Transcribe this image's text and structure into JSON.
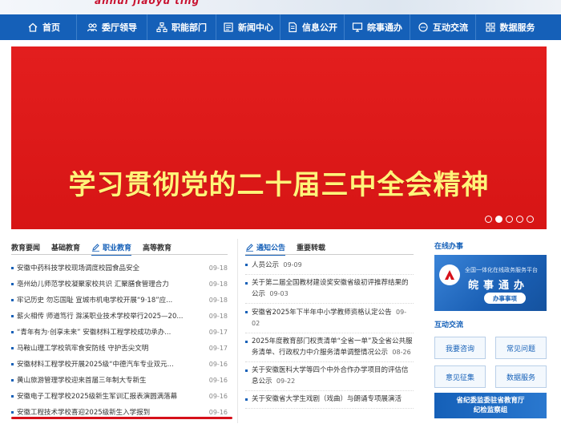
{
  "top": {
    "brand": "anhui jiaoyu ting"
  },
  "nav": [
    {
      "label": "首页",
      "icon": "home-icon"
    },
    {
      "label": "委厅领导",
      "icon": "users-icon"
    },
    {
      "label": "职能部门",
      "icon": "org-chart-icon"
    },
    {
      "label": "新闻中心",
      "icon": "newspaper-icon"
    },
    {
      "label": "信息公开",
      "icon": "document-icon"
    },
    {
      "label": "皖事通办",
      "icon": "monitor-icon"
    },
    {
      "label": "互动交流",
      "icon": "chat-icon"
    },
    {
      "label": "数据服务",
      "icon": "grid-icon"
    }
  ],
  "hero": {
    "title": "学习贯彻党的二十届三中全会精神",
    "slides": 5,
    "active_slide": 2
  },
  "left_tabs": [
    "教育要闻",
    "基础教育",
    "职业教育",
    "高等教育"
  ],
  "left_active_tab": "职业教育",
  "news": [
    {
      "title": "安徽中药科技学校现场调度校园食品安全",
      "date": "09-18"
    },
    {
      "title": "亳州幼儿师范学校凝聚家校共识 汇聚膳食管理合力",
      "date": "09-18"
    },
    {
      "title": "牢记历史 勿忘国耻 宣城市机电学校开展“9·18”应...",
      "date": "09-18"
    },
    {
      "title": "薪火相传 师道笃行 滁溪职业技术学校举行2025—20...",
      "date": "09-18"
    },
    {
      "title": "“青年有为·创享未来” 安徽材料工程学校成功承办...",
      "date": "09-17"
    },
    {
      "title": "马鞍山理工学校筑牢食安防线 守护舌尖文明",
      "date": "09-17"
    },
    {
      "title": "安徽材料工程学校开展2025级“中德汽车专业双元...",
      "date": "09-16"
    },
    {
      "title": "黄山旅游管理学校迎来首届三年制大专新生",
      "date": "09-16"
    },
    {
      "title": "安徽电子工程学校2025级新生军训汇报表演圆满落幕",
      "date": "09-16"
    },
    {
      "title": "安徽工程技术学校喜迎2025级新生入学报到",
      "date": "09-16"
    }
  ],
  "mid_tabs": [
    "通知公告",
    "重要转载"
  ],
  "mid_active_tab": "通知公告",
  "announcements": [
    {
      "title": "人员公示",
      "date": "09-09"
    },
    {
      "title": "关于第二届全国教材建设奖安徽省级初评推荐结果的公示",
      "date": "09-03"
    },
    {
      "title": "安徽省2025年下半年中小学教师资格认定公告",
      "date": "09-02"
    },
    {
      "title": "2025年度教育部门权责清单“全省一单”及全省公共服务清单、行政权力中介服务清单调整情况公示",
      "date": "08-26"
    },
    {
      "title": "关于安徽医科大学等四个中外合作办学项目的评估信息公示",
      "date": "09-22"
    },
    {
      "title": "关于安徽省大学生戏剧（戏曲）与朗诵专项展演活",
      "date": ""
    }
  ],
  "right": {
    "online_title": "在线办事",
    "wanshi_sub": "全国一体化在线政务服务平台",
    "wanshi_main": "皖事通办",
    "wanshi_btn": "办事事项",
    "interact_title": "互动交流",
    "buttons": [
      "我要咨询",
      "常见问题",
      "意见征集",
      "数据服务"
    ],
    "jijian_line1": "省纪委监委驻省教育厅",
    "jijian_line2": "纪检监察组"
  },
  "colors": {
    "nav_blue": "#1560b8",
    "hero_red": "#e01b1b",
    "hero_text": "#fff47a",
    "accent_red": "#d6101a"
  }
}
